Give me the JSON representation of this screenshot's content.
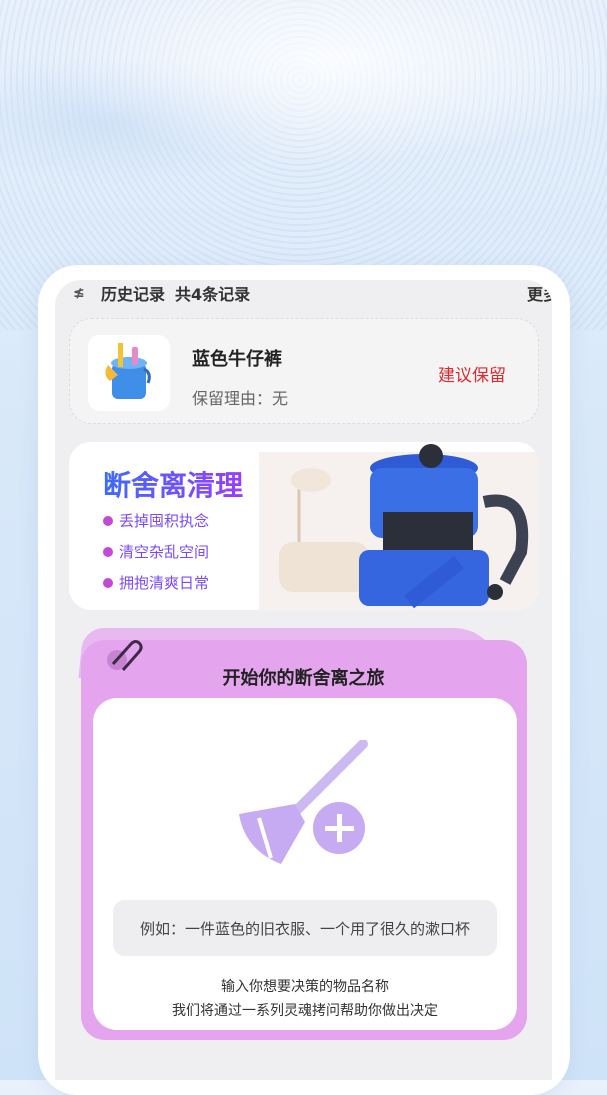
{
  "history": {
    "title": "历史记录",
    "count": "共4条记录",
    "more": "更多"
  },
  "record": {
    "name": "蓝色牛仔裤",
    "reason": "保留理由：无",
    "suggestion": "建议保留"
  },
  "banner": {
    "title": "断舍离清理",
    "bullets": [
      "丢掉囤积执念",
      "清空杂乱空间",
      "拥抱清爽日常"
    ]
  },
  "start": {
    "title": "开始你的断舍离之旅",
    "example": "例如：一件蓝色的旧衣服、一个用了很久的漱口杯",
    "hint_line1": "输入你想要决策的物品名称",
    "hint_line2": "我们将通过一系列灵魂拷问帮助你做出决定"
  },
  "icons": {
    "history": "history-icon",
    "bucket": "cleaning-bucket-icon",
    "vacuum": "vacuum-cleaner-icon",
    "clip": "paperclip-icon",
    "broom_add": "broom-add-icon"
  }
}
